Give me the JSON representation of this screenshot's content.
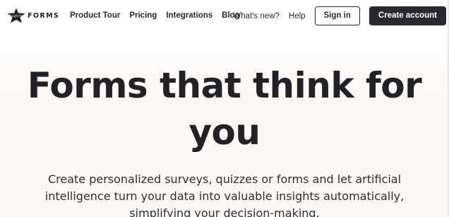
{
  "brand": {
    "logo_text": "FORMS",
    "logo_mark_text": "Youform",
    "accent": "#2a2930"
  },
  "nav": {
    "links": [
      {
        "label": "Product Tour"
      },
      {
        "label": "Pricing"
      },
      {
        "label": "Integrations"
      },
      {
        "label": "Blog"
      }
    ],
    "whats_new": "What's new?",
    "help": "Help",
    "sign_in": "Sign in",
    "create_account": "Create account"
  },
  "hero": {
    "title_line1": "Forms that think for",
    "title_line2": "you",
    "subtitle": "Create personalized surveys, quizzes or forms and let artificial intelligence turn your data into valuable insights automatically, simplifying your decision-making."
  }
}
